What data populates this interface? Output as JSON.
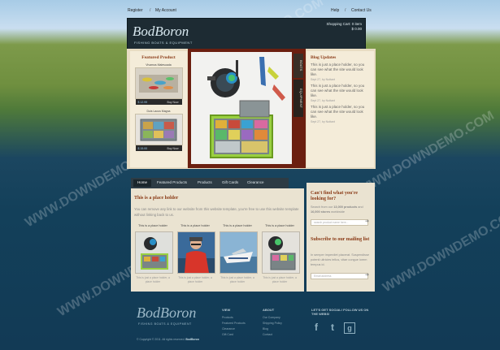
{
  "top_links": {
    "register": "Register",
    "account": "My Account",
    "help": "Help",
    "contact": "Contact Us",
    "separator": "/"
  },
  "brand": {
    "logo": "BodBoron",
    "tagline": "FISHING BOATS & EQUIPMENT"
  },
  "cart": {
    "line1": "Shopping Cart: 0 item",
    "line2": "$ 0.00"
  },
  "featured": {
    "title": "Featured Product",
    "items": [
      {
        "name": "Vivamus Malesuada",
        "price": "$ 12.99",
        "buy": "Buy Now"
      },
      {
        "name": "Duis Lacus Magna",
        "price": "$ 15.00",
        "buy": "Buy Now"
      }
    ]
  },
  "hero": {
    "tab_top": "BOATS",
    "tab_bottom": "EQUIPMENT"
  },
  "blog": {
    "title": "Blog Updates",
    "posts": [
      {
        "text": "This is just a place holder, so you can see what the site would look like.",
        "meta": "Sept 27, by Nuttant"
      },
      {
        "text": "This is just a place holder, so you can see what the site would look like.",
        "meta": "Sept 27, by Nuttant"
      },
      {
        "text": "This is just a place holder, so you can see what the site would look like.",
        "meta": "Sept 27, by Nuttant"
      }
    ]
  },
  "nav": [
    "Home",
    "Featured Products",
    "Products",
    "Gift Cards",
    "Clearance"
  ],
  "main": {
    "title": "This is a place holder",
    "text": "You can remove any link to our website from this website template, you're free to use this website template without linking back to us.",
    "cards": [
      {
        "caption": "This is a place holder",
        "footer": "This is just a place holder, a place holder"
      },
      {
        "caption": "This is a place holder",
        "footer": "This is just a place holder, a place holder"
      },
      {
        "caption": "This is a place holder",
        "footer": "This is just a place holder, a place holder"
      },
      {
        "caption": "This is a place holder",
        "footer": "This is just a place holder, a place holder"
      }
    ]
  },
  "side": {
    "search_title": "Can't find what you're looking for?",
    "search_text_plain": "Search from our",
    "search_text_bold1": "13,000 products",
    "search_text_and": "and",
    "search_text_bold2": "16,000 stores",
    "search_text_end": "worldwide",
    "search_placeholder": "search product name here...",
    "go": "➜",
    "sub_title": "Subscribe to our mailing list",
    "sub_text": "In semper imperdiet placerat. Suspendisse potenti ultricies tellus, vitae congue lorem tempus id.",
    "email_placeholder": "Email address"
  },
  "footer": {
    "logo": "BodBoron",
    "tagline": "FISHING BOATS & EQUIPMENT",
    "col1_title": "VIEW",
    "col1_items": [
      "Products",
      "Featured Products",
      "Clearance",
      "Gift Card"
    ],
    "col2_title": "ABOUT",
    "col2_items": [
      "Our Company",
      "Shipping Policy",
      "Blog",
      "Contact"
    ],
    "social_title": "LET'S GET SOCIAL! FOLLOW US ON THE WEBS!",
    "social": [
      "f",
      "t",
      "g"
    ],
    "copyright_prefix": "© Copyright © 2011. All rights reserved.",
    "copyright_link": "BodBoron"
  },
  "colors": {
    "accent": "#8a3a16",
    "header": "#1d2b33",
    "panel": "#f4ecd9",
    "frame": "#6b1f10"
  }
}
